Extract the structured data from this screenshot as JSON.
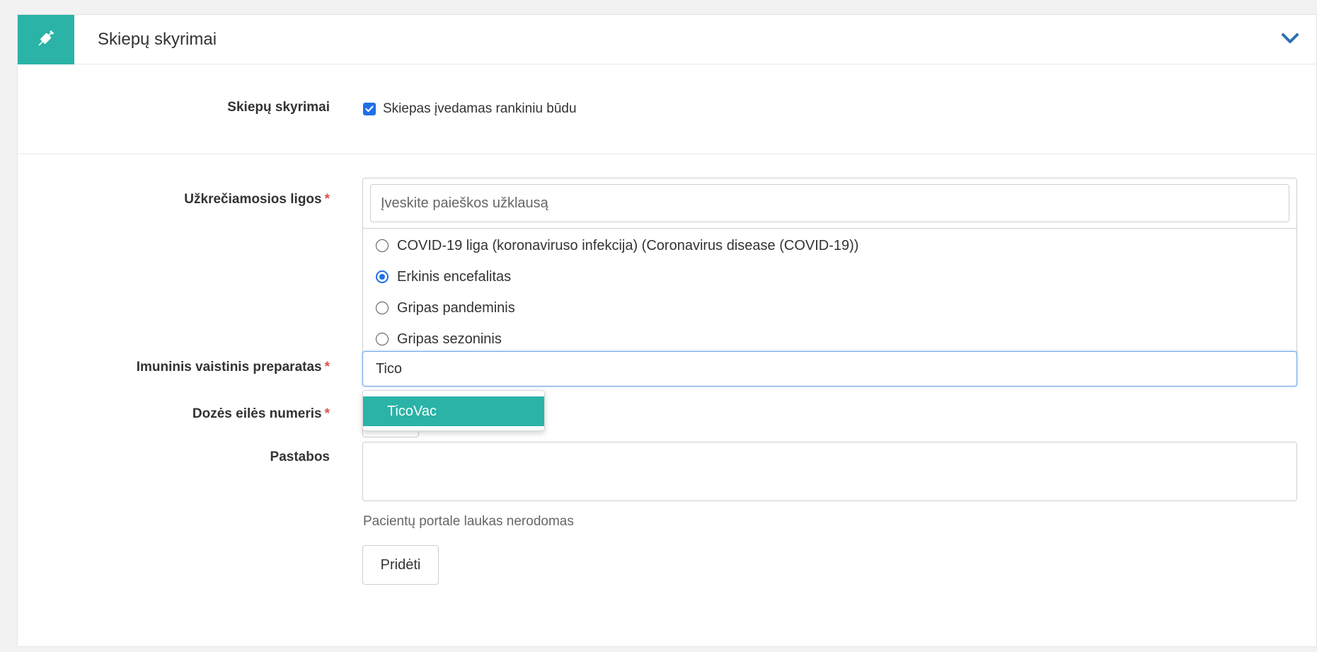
{
  "panel": {
    "title": "Skiepų skyrimai",
    "accent_color": "#2ab3a6",
    "header_icon": "syringe-icon",
    "collapse_icon": "chevron-down-icon"
  },
  "manual_entry": {
    "label": "Skiepų skyrimai",
    "checkbox_label": "Skiepas įvedamas rankiniu būdu",
    "checked": true
  },
  "diseases": {
    "label": "Užkrečiamosios ligos",
    "required_mark": "*",
    "search_placeholder": "Įveskite paieškos užklausą",
    "options": [
      {
        "label": "COVID-19 liga (koronaviruso infekcija) (Coronavirus disease (COVID-19))",
        "selected": false
      },
      {
        "label": "Erkinis encefalitas",
        "selected": true
      },
      {
        "label": "Gripas pandeminis",
        "selected": false
      },
      {
        "label": "Gripas sezoninis",
        "selected": false
      }
    ]
  },
  "vaccine": {
    "label": "Imuninis vaistinis preparatas",
    "required_mark": "*",
    "value": "Tico",
    "suggestions": [
      "TicoVac"
    ]
  },
  "dose": {
    "label": "Dozės eilės numeris",
    "required_mark": "*"
  },
  "notes": {
    "label": "Pastabos",
    "hint": "Pacientų portale laukas nerodomas"
  },
  "actions": {
    "add_label": "Pridėti"
  }
}
